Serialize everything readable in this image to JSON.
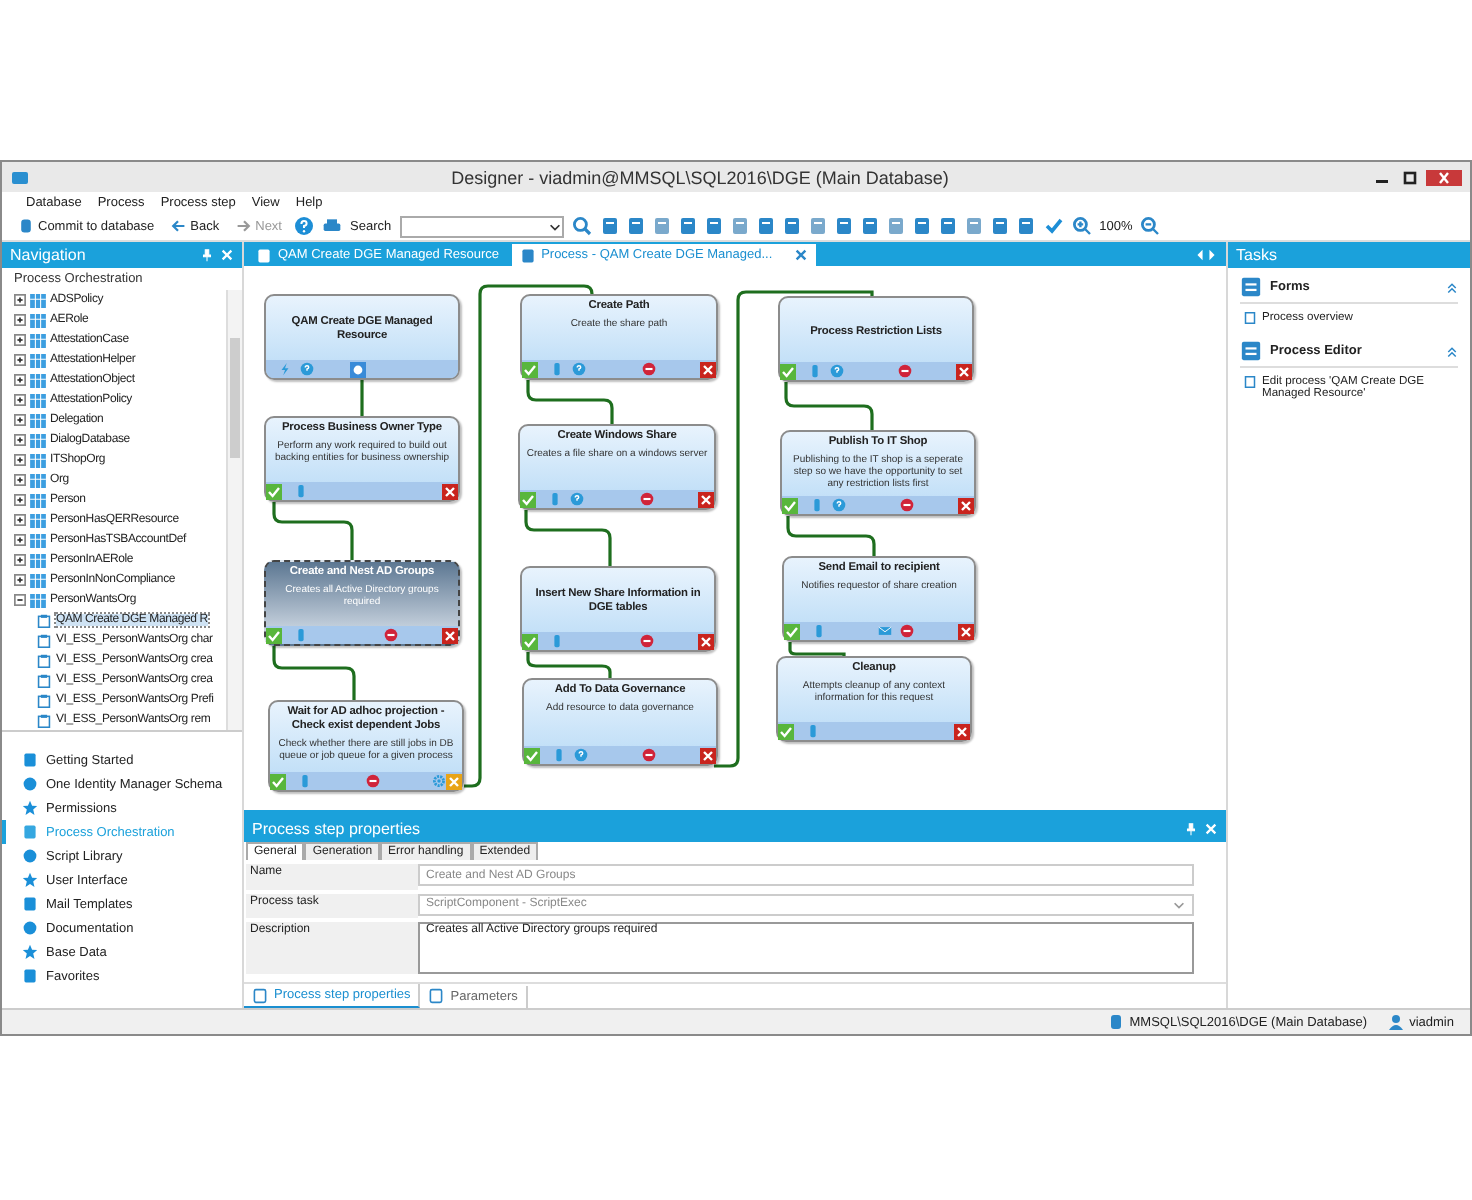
{
  "window": {
    "title": "Designer - viadmin@MMSQL\\SQL2016\\DGE (Main Database)"
  },
  "menu": [
    {
      "label": "Database"
    },
    {
      "label": "Process"
    },
    {
      "label": "Process step"
    },
    {
      "label": "View"
    },
    {
      "label": "Help"
    }
  ],
  "toolbar": {
    "commit": "Commit to database",
    "back": {
      "label": "Back",
      "disabled": false
    },
    "next": {
      "label": "Next",
      "disabled": true
    },
    "search_label": "Search",
    "zoom": "100%"
  },
  "navigation": {
    "title": "Navigation",
    "tree_label": "Process Orchestration",
    "tree": [
      {
        "label": "ADSPolicy",
        "expanded": false,
        "selected": false
      },
      {
        "label": "AERole",
        "expanded": false,
        "selected": false
      },
      {
        "label": "AttestationCase",
        "expanded": false,
        "selected": false
      },
      {
        "label": "AttestationHelper",
        "expanded": false,
        "selected": false
      },
      {
        "label": "AttestationObject",
        "expanded": false,
        "selected": false
      },
      {
        "label": "AttestationPolicy",
        "expanded": false,
        "selected": false
      },
      {
        "label": "Delegation",
        "expanded": false,
        "selected": false
      },
      {
        "label": "DialogDatabase",
        "expanded": false,
        "selected": false
      },
      {
        "label": "ITShopOrg",
        "expanded": false,
        "selected": false
      },
      {
        "label": "Org",
        "expanded": false,
        "selected": false
      },
      {
        "label": "Person",
        "expanded": false,
        "selected": false
      },
      {
        "label": "PersonHasQERResource",
        "expanded": false,
        "selected": false
      },
      {
        "label": "PersonHasTSBAccountDef",
        "expanded": false,
        "selected": false
      },
      {
        "label": "PersonInAERole",
        "expanded": false,
        "selected": false
      },
      {
        "label": "PersonInNonCompliance",
        "expanded": false,
        "selected": false
      },
      {
        "label": "PersonWantsOrg",
        "expanded": true,
        "selected": false,
        "children": [
          {
            "label": "QAM Create DGE Managed R",
            "selected": true
          },
          {
            "label": "VI_ESS_PersonWantsOrg char",
            "selected": false
          },
          {
            "label": "VI_ESS_PersonWantsOrg crea",
            "selected": false
          },
          {
            "label": "VI_ESS_PersonWantsOrg crea",
            "selected": false
          },
          {
            "label": "VI_ESS_PersonWantsOrg Prefi",
            "selected": false
          },
          {
            "label": "VI_ESS_PersonWantsOrg rem",
            "selected": false
          }
        ]
      }
    ],
    "sections": [
      {
        "label": "Getting Started",
        "selected": false
      },
      {
        "label": "One Identity Manager Schema",
        "selected": false
      },
      {
        "label": "Permissions",
        "selected": false
      },
      {
        "label": "Process Orchestration",
        "selected": true
      },
      {
        "label": "Script Library",
        "selected": false
      },
      {
        "label": "User Interface",
        "selected": false
      },
      {
        "label": "Mail Templates",
        "selected": false
      },
      {
        "label": "Documentation",
        "selected": false
      },
      {
        "label": "Base Data",
        "selected": false
      },
      {
        "label": "Favorites",
        "selected": false
      }
    ]
  },
  "document_tabs": [
    {
      "label": "QAM Create DGE Managed Resource",
      "selected": false
    },
    {
      "label": "Process - QAM Create DGE Managed...",
      "selected": true
    }
  ],
  "canvas": {
    "nodes": [
      {
        "title": "QAM Create DGE Managed Resource",
        "selected": false,
        "ports": [
          {
            "kind": "event"
          },
          {
            "kind": "help"
          },
          {
            "kind": "start"
          }
        ]
      },
      {
        "title": "Process Business Owner Type",
        "description": "Perform any work required to build out backing entities for business ownership",
        "selected": false,
        "ports": [
          {
            "kind": "success"
          },
          {
            "kind": "data"
          },
          {
            "kind": "fail"
          }
        ]
      },
      {
        "title": "Create and Nest AD Groups",
        "description": "Creates all Active Directory groups required",
        "selected": true,
        "ports": [
          {
            "kind": "success"
          },
          {
            "kind": "data"
          },
          {
            "kind": "stop"
          },
          {
            "kind": "fail"
          }
        ]
      },
      {
        "title": "Wait for AD adhoc projection - Check exist dependent Jobs",
        "description": "Check whether there are still jobs in DB queue or job queue for a given process",
        "selected": false,
        "ports": [
          {
            "kind": "success"
          },
          {
            "kind": "data"
          },
          {
            "kind": "stop"
          },
          {
            "kind": "gear"
          },
          {
            "kind": "fail-warn"
          }
        ]
      },
      {
        "title": "Create Path",
        "description": "Create the share path",
        "selected": false,
        "ports": [
          {
            "kind": "success"
          },
          {
            "kind": "data"
          },
          {
            "kind": "help"
          },
          {
            "kind": "stop"
          },
          {
            "kind": "fail"
          }
        ]
      },
      {
        "title": "Create Windows Share",
        "description": "Creates a file share on a windows server",
        "selected": false,
        "ports": [
          {
            "kind": "success"
          },
          {
            "kind": "data"
          },
          {
            "kind": "help"
          },
          {
            "kind": "stop"
          },
          {
            "kind": "fail"
          }
        ]
      },
      {
        "title": "Insert New Share Information in DGE tables",
        "selected": false,
        "ports": [
          {
            "kind": "success"
          },
          {
            "kind": "data"
          },
          {
            "kind": "stop"
          },
          {
            "kind": "fail"
          }
        ]
      },
      {
        "title": "Add To Data Governance",
        "description": "Add resource to data governance",
        "selected": false,
        "ports": [
          {
            "kind": "success"
          },
          {
            "kind": "data"
          },
          {
            "kind": "help"
          },
          {
            "kind": "stop"
          },
          {
            "kind": "fail"
          }
        ]
      },
      {
        "title": "Process Restriction Lists",
        "selected": false,
        "ports": [
          {
            "kind": "success"
          },
          {
            "kind": "data"
          },
          {
            "kind": "help"
          },
          {
            "kind": "stop"
          },
          {
            "kind": "fail"
          }
        ]
      },
      {
        "title": "Publish To IT Shop",
        "description": "Publishing to the IT shop is a seperate step so we have the opportunity to set any restriction lists first",
        "selected": false,
        "ports": [
          {
            "kind": "success"
          },
          {
            "kind": "data"
          },
          {
            "kind": "help"
          },
          {
            "kind": "stop"
          },
          {
            "kind": "fail"
          }
        ]
      },
      {
        "title": "Send Email to recipient",
        "description": "Notifies requestor of share creation",
        "selected": false,
        "ports": [
          {
            "kind": "success"
          },
          {
            "kind": "data"
          },
          {
            "kind": "mail"
          },
          {
            "kind": "stop"
          },
          {
            "kind": "fail"
          }
        ]
      },
      {
        "title": "Cleanup",
        "description": "Attempts cleanup of any context information for this request",
        "selected": false,
        "ports": [
          {
            "kind": "success"
          },
          {
            "kind": "data"
          },
          {
            "kind": "fail"
          }
        ]
      }
    ]
  },
  "properties": {
    "title": "Process step properties",
    "tabs": [
      {
        "label": "General",
        "selected": true
      },
      {
        "label": "Generation",
        "selected": false
      },
      {
        "label": "Error handling",
        "selected": false
      },
      {
        "label": "Extended",
        "selected": false
      }
    ],
    "fields": [
      {
        "label": "Name",
        "kind": "text",
        "value": "Create and Nest AD Groups",
        "disabled": true
      },
      {
        "label": "Process task",
        "kind": "select",
        "value": "ScriptComponent - ScriptExec",
        "disabled": true
      },
      {
        "label": "Description",
        "kind": "textarea",
        "value": "Creates all Active Directory groups required",
        "disabled": false
      }
    ],
    "bottom_tabs": [
      {
        "label": "Process step properties",
        "selected": true
      },
      {
        "label": "Parameters",
        "selected": false
      }
    ]
  },
  "tasks": {
    "title": "Tasks",
    "groups": [
      {
        "title": "Forms",
        "items": [
          "Process overview"
        ]
      },
      {
        "title": "Process Editor",
        "items": [
          "Edit process 'QAM Create DGE Managed Resource'"
        ]
      }
    ]
  },
  "status_bar": {
    "database": "MMSQL\\SQL2016\\DGE (Main Database)",
    "user": "viadmin"
  }
}
